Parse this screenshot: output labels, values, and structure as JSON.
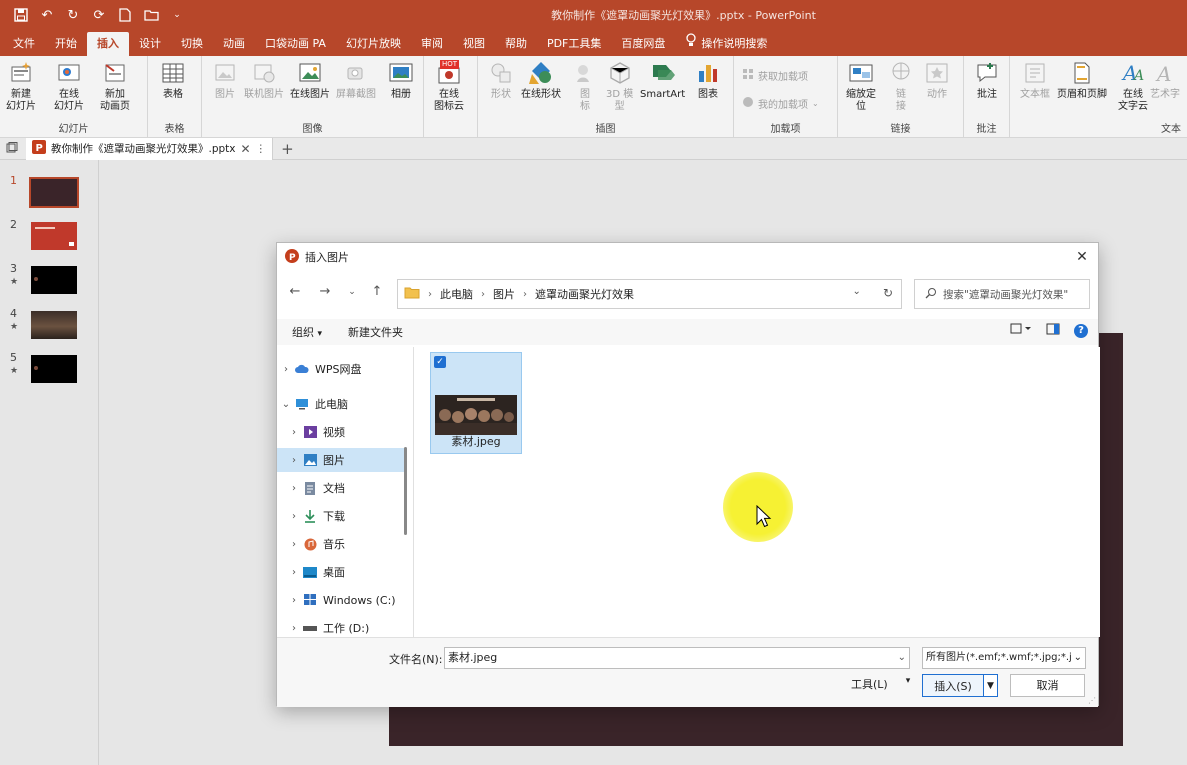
{
  "window": {
    "title": "教你制作《遮罩动画聚光灯效果》.pptx  -  PowerPoint"
  },
  "menu_tabs": [
    {
      "label": "文件"
    },
    {
      "label": "开始"
    },
    {
      "label": "插入",
      "active": true
    },
    {
      "label": "设计"
    },
    {
      "label": "切换"
    },
    {
      "label": "动画"
    },
    {
      "label": "口袋动画 PA"
    },
    {
      "label": "幻灯片放映"
    },
    {
      "label": "审阅"
    },
    {
      "label": "视图"
    },
    {
      "label": "帮助"
    },
    {
      "label": "PDF工具集"
    },
    {
      "label": "百度网盘"
    },
    {
      "label": "操作说明搜索"
    }
  ],
  "ribbon": {
    "groups": {
      "slides": "幻灯片",
      "tables": "表格",
      "images": "图像",
      "illustrations": "插图",
      "addins": "加载项",
      "links": "链接",
      "comments": "批注",
      "text": "文本"
    },
    "buttons": {
      "new_slide": "新建\n幻灯片",
      "online_slide": "在线\n幻灯片",
      "new_anim_page": "新加\n动画页",
      "table": "表格",
      "picture": "图片",
      "online_pic": "联机图片",
      "web_pic": "在线图片",
      "screenshot": "屏幕截图",
      "album": "相册",
      "online_icons": "在线\n图标云",
      "hot_badge": "HOT",
      "shapes": "形状",
      "online_shapes": "在线形状",
      "icons": "图\n标",
      "model3d": "3D 模\n型",
      "smartart": "SmartArt",
      "chart": "图表",
      "get_addins": "获取加载项",
      "my_addins": "我的加载项",
      "zoom": "缩放定\n位",
      "link": "链\n接",
      "action": "动作",
      "comment": "批注",
      "textbox": "文本框",
      "header_footer": "页眉和页脚",
      "online_text": "在线\n文字云",
      "wordart": "艺术字"
    }
  },
  "doc_tab": {
    "label": "教你制作《遮罩动画聚光灯效果》.pptx"
  },
  "thumbnails": [
    {
      "num": "1",
      "star": ""
    },
    {
      "num": "2",
      "star": ""
    },
    {
      "num": "3",
      "star": "★"
    },
    {
      "num": "4",
      "star": "★"
    },
    {
      "num": "5",
      "star": "★"
    }
  ],
  "dialog": {
    "title": "插入图片",
    "breadcrumb": [
      "此电脑",
      "图片",
      "遮罩动画聚光灯效果"
    ],
    "search_placeholder": "搜索\"遮罩动画聚光灯效果\"",
    "organize": "组织",
    "new_folder": "新建文件夹",
    "nav_items": [
      {
        "label": "WPS网盘",
        "icon": "cloud-icon"
      },
      {
        "label": "此电脑",
        "icon": "computer-icon",
        "expanded": true
      },
      {
        "label": "视频",
        "icon": "video-folder-icon"
      },
      {
        "label": "图片",
        "icon": "pictures-folder-icon",
        "selected": true
      },
      {
        "label": "文档",
        "icon": "documents-folder-icon"
      },
      {
        "label": "下载",
        "icon": "download-icon"
      },
      {
        "label": "音乐",
        "icon": "music-icon"
      },
      {
        "label": "桌面",
        "icon": "desktop-icon"
      },
      {
        "label": "Windows (C:)",
        "icon": "drive-c-icon"
      },
      {
        "label": "工作 (D:)",
        "icon": "drive-d-icon"
      }
    ],
    "files": [
      {
        "name": "素材.jpeg",
        "selected": true
      }
    ],
    "filename_label": "文件名(N):",
    "filename_value": "素材.jpeg",
    "filter_value": "所有图片(*.emf;*.wmf;*.jpg;*.jp",
    "tools": "工具(L)",
    "insert": "插入(S)",
    "cancel": "取消"
  },
  "colors": {
    "accent": "#b7472a",
    "selection": "#cce4f7",
    "slide_bg": "#3a2429"
  }
}
